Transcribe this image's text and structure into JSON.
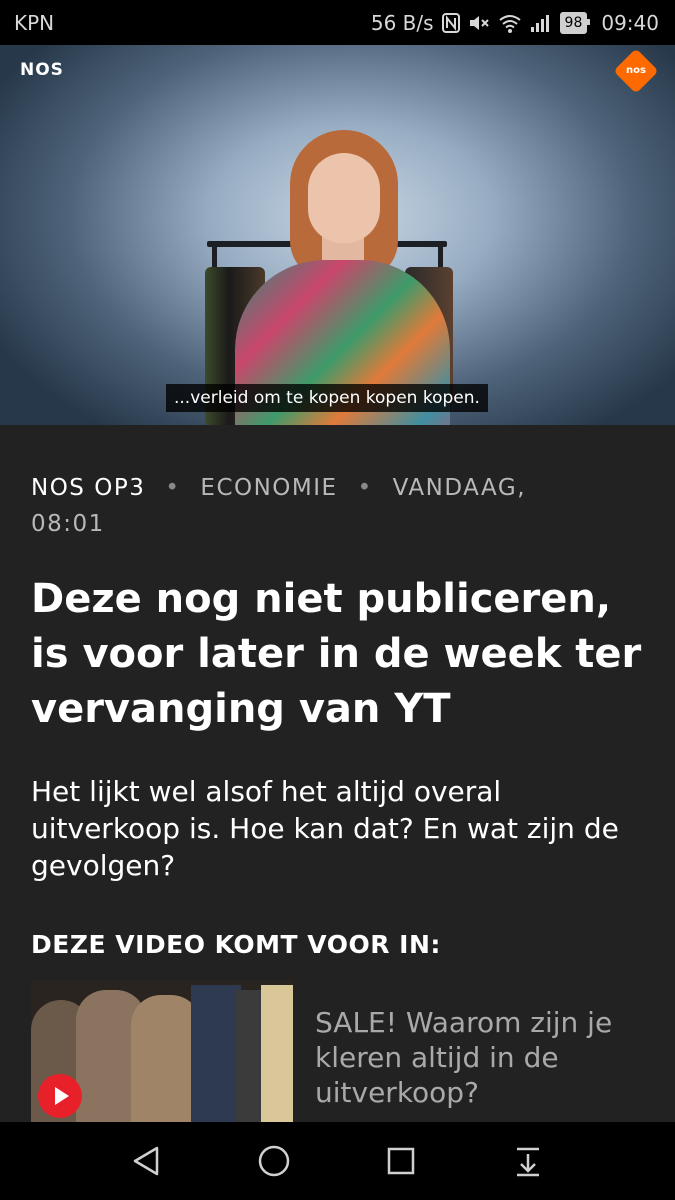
{
  "status_bar": {
    "carrier": "KPN",
    "speed": "56 B/s",
    "battery": "98",
    "time": "09:40",
    "icons": [
      "nfc-icon",
      "mute-icon",
      "wifi-icon",
      "signal-icon",
      "battery-icon"
    ]
  },
  "video": {
    "logo": "NOS",
    "corner_badge": "nos",
    "subtitle": "...verleid om te kopen kopen kopen."
  },
  "meta": {
    "source": "NOS OP3",
    "category": "ECONOMIE",
    "separator": "•",
    "date": "VANDAAG,",
    "time": "08:01"
  },
  "headline": "Deze nog niet publiceren, is voor later in de week ter vervanging van YT",
  "lead": "Het lijkt wel alsof het altijd overal uitverkoop is. Hoe kan dat? En wat zijn de gevolgen?",
  "section": {
    "title": "DEZE VIDEO KOMT VOOR IN:"
  },
  "card": {
    "title": "SALE! Waarom zijn je kleren altijd in de uitverkoop?"
  },
  "colors": {
    "background": "#222222",
    "play_button": "#e8202a",
    "nos_orange": "#ff6a00"
  }
}
